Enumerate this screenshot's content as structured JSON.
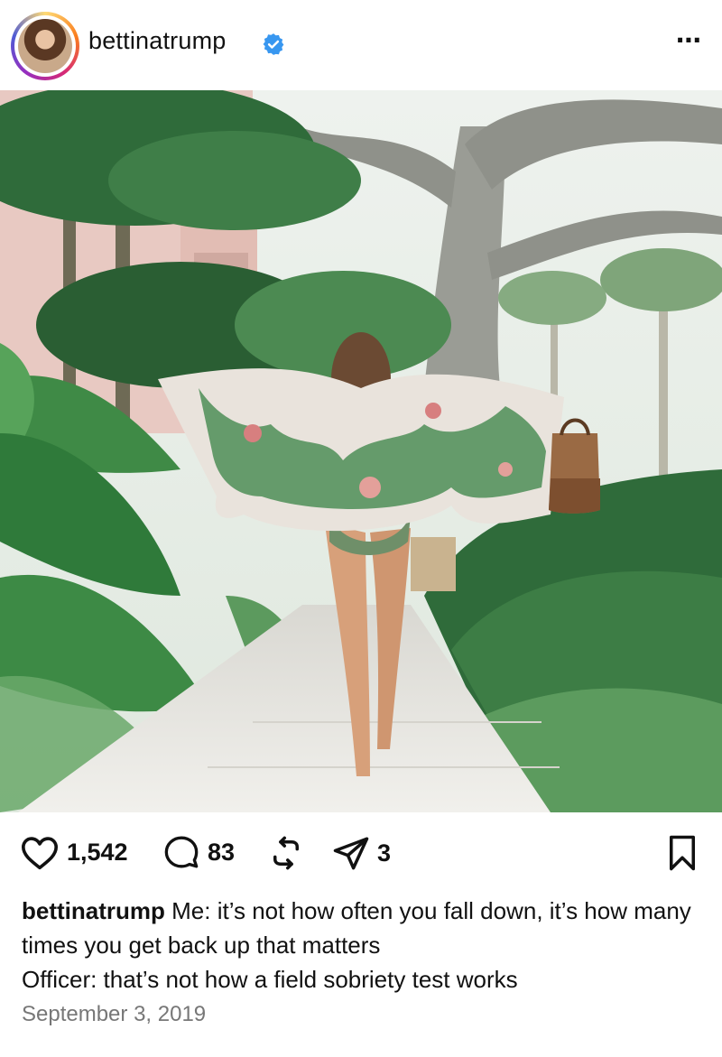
{
  "post": {
    "username": "bettinatrump",
    "verified": true,
    "more_icon": "⋯"
  },
  "photo": {
    "alt": "Woman in a tropical-print cover-up walking down a garden path holding a brown bag"
  },
  "actions": {
    "likes": "1,542",
    "comments": "83",
    "shares": "3"
  },
  "caption": {
    "username": "bettinatrump",
    "line1": "Me: it’s not how often you fall down, it’s how many times you get back up that matters",
    "line2": "Officer: that’s not how a field sobriety test works"
  },
  "date": "September 3, 2019",
  "colors": {
    "verified_blue": "#3897f0",
    "path": "#e7e5df",
    "foliage_dark": "#2f6b3a",
    "foliage_light": "#6aa86a"
  }
}
